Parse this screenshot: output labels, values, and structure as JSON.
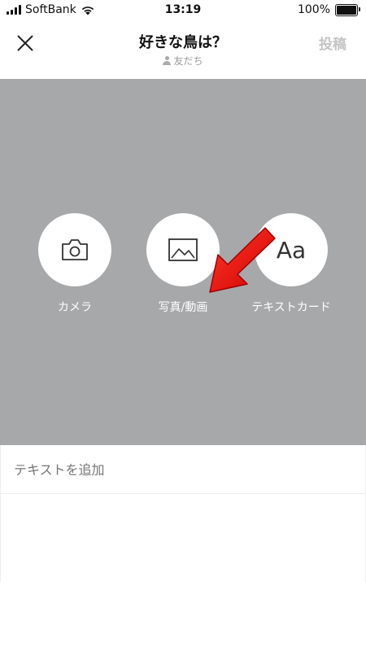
{
  "status_bar": {
    "carrier": "SoftBank",
    "time": "13:19",
    "battery": "100%",
    "battery_level": 1.0
  },
  "header": {
    "title": "好きな鳥は？",
    "audience": "友だち",
    "post_label": "投稿"
  },
  "media_options": [
    {
      "label": "カメラ",
      "icon": "camera-icon"
    },
    {
      "label": "写真/動画",
      "icon": "image-icon"
    },
    {
      "label": "テキストカード",
      "icon": "text-card-icon",
      "icon_text": "Aa"
    }
  ],
  "text_input": {
    "placeholder": "テキストを追加"
  },
  "colors": {
    "media_bg": "#a7a8aa",
    "arrow": "#e00000",
    "post_disabled": "#c4c4c4"
  }
}
